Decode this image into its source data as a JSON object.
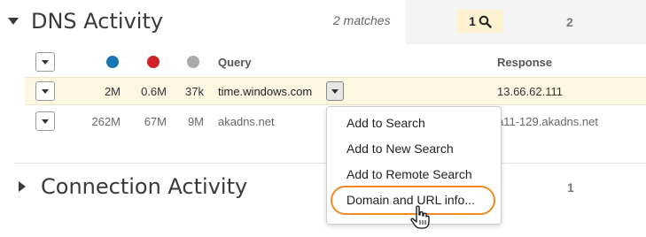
{
  "dns_section": {
    "title": "DNS Activity",
    "matches": "2 matches",
    "tabs": [
      {
        "label": "1"
      },
      {
        "label": "2"
      }
    ]
  },
  "status_colors": {
    "blue": "#1a76b2",
    "red": "#d0202a",
    "gray": "#aaaaaa"
  },
  "columns": {
    "query": "Query",
    "response": "Response"
  },
  "rows": [
    {
      "c1": "2M",
      "c2": "0.6M",
      "c3": "37k",
      "query": "time.windows.com",
      "response": "13.66.62.111"
    },
    {
      "c1": "262M",
      "c2": "67M",
      "c3": "9M",
      "query": "akadns.net",
      "response": "a11-129.akadns.net"
    }
  ],
  "context_menu": {
    "items": [
      "Add to Search",
      "Add to New Search",
      "Add to Remote Search",
      "Domain and URL info..."
    ]
  },
  "connection_section": {
    "title": "Connection Activity",
    "tab": "1"
  }
}
